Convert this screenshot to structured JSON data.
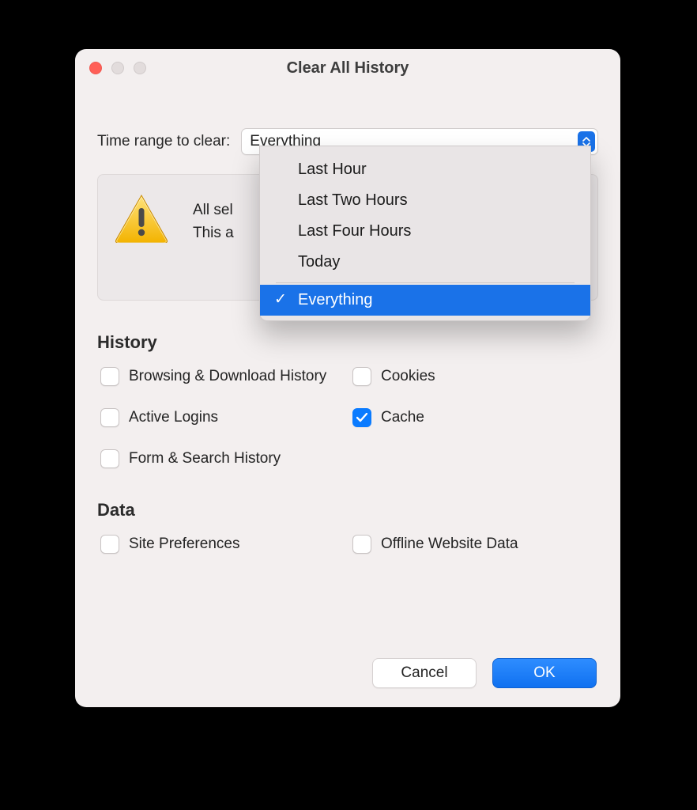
{
  "dialog": {
    "title": "Clear All History",
    "time_range_label": "Time range to clear:",
    "time_range_value": "Everything",
    "time_range_options": {
      "opt0": "Last Hour",
      "opt1": "Last Two Hours",
      "opt2": "Last Four Hours",
      "opt3": "Today",
      "opt4": "Everything"
    },
    "warning": {
      "line1": "All sel",
      "line2": "This a"
    },
    "sections": {
      "history_title": "History",
      "data_title": "Data"
    },
    "checks": {
      "browsing": {
        "label": "Browsing & Download History",
        "checked": false
      },
      "cookies": {
        "label": "Cookies",
        "checked": false
      },
      "logins": {
        "label": "Active Logins",
        "checked": false
      },
      "cache": {
        "label": "Cache",
        "checked": true
      },
      "form": {
        "label": "Form & Search History",
        "checked": false
      },
      "siteprefs": {
        "label": "Site Preferences",
        "checked": false
      },
      "offline": {
        "label": "Offline Website Data",
        "checked": false
      }
    },
    "buttons": {
      "cancel": "Cancel",
      "ok": "OK"
    }
  }
}
